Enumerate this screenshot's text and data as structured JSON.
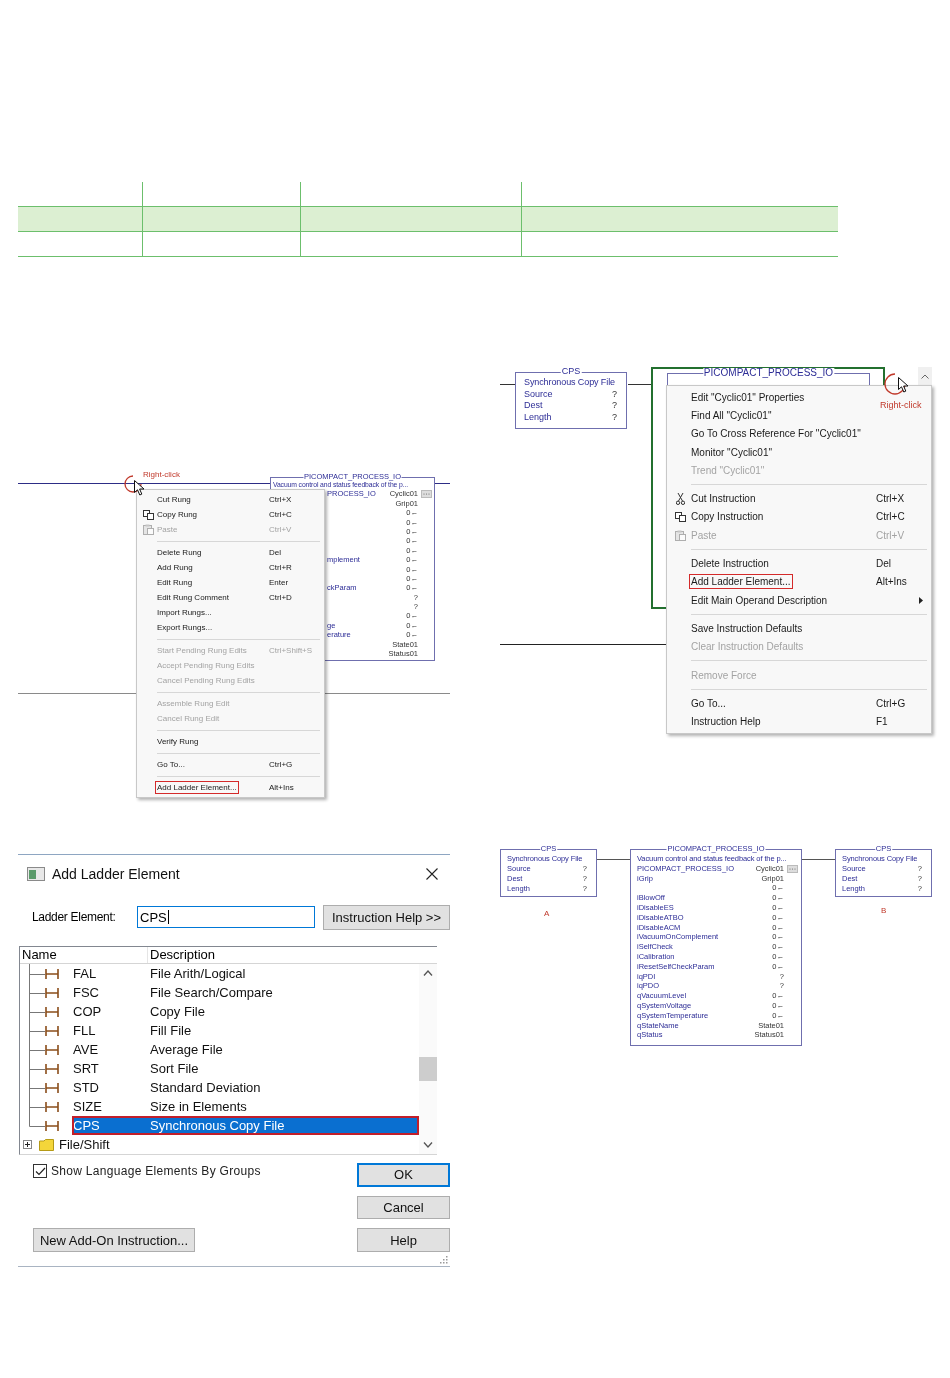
{
  "table": {
    "rows": [
      {
        "shaded": false
      },
      {
        "shaded": true
      },
      {
        "shaded": false
      }
    ]
  },
  "rung_menu_figure": {
    "callout": "Right-click",
    "instruction": {
      "title": "PICOMPACT_PROCESS_IO",
      "description": "Vacuum control and status feedback of the p...",
      "rows": [
        {
          "name": "PROCESS_IO",
          "value": "Cyclic01",
          "browse": true
        },
        {
          "value": "Grip01"
        },
        {
          "value": "0←"
        },
        {
          "value": "0←"
        },
        {
          "value": "0←"
        },
        {
          "value": "0←"
        },
        {
          "value": "0←"
        },
        {
          "name": "mplement",
          "value": "0←"
        },
        {
          "value": "0←"
        },
        {
          "value": "0←"
        },
        {
          "name": "ckParam",
          "value": "0←"
        },
        {
          "value": "?"
        },
        {
          "value": "?"
        },
        {
          "value": "0←"
        },
        {
          "name": "ge",
          "value": "0←"
        },
        {
          "name": "erature",
          "value": "0←"
        },
        {
          "value": "State01"
        },
        {
          "value": "Status01"
        }
      ]
    },
    "menu": {
      "groups": [
        {
          "items": [
            {
              "kind": "plain",
              "label": "Cut Rung",
              "shortcut": "Ctrl+X",
              "disabled": false,
              "boxed": false
            },
            {
              "kind": "copy",
              "label": "Copy Rung",
              "shortcut": "Ctrl+C",
              "disabled": false,
              "boxed": false
            },
            {
              "kind": "paste",
              "label": "Paste",
              "shortcut": "Ctrl+V",
              "disabled": true,
              "boxed": false
            }
          ]
        },
        {
          "items": [
            {
              "label": "Delete Rung",
              "shortcut": "Del",
              "disabled": false,
              "boxed": false
            },
            {
              "label": "Add Rung",
              "shortcut": "Ctrl+R",
              "disabled": false,
              "boxed": false
            },
            {
              "label": "Edit Rung",
              "shortcut": "Enter",
              "disabled": false,
              "boxed": false
            },
            {
              "label": "Edit Rung Comment",
              "shortcut": "Ctrl+D",
              "disabled": false,
              "boxed": false
            },
            {
              "label": "Import Rungs...",
              "disabled": false,
              "boxed": false
            },
            {
              "label": "Export Rungs...",
              "disabled": false,
              "boxed": false
            }
          ]
        },
        {
          "items": [
            {
              "label": "Start Pending Rung Edits",
              "shortcut": "Ctrl+Shift+S",
              "disabled": true,
              "boxed": false
            },
            {
              "label": "Accept Pending Rung Edits",
              "disabled": true,
              "boxed": false
            },
            {
              "label": "Cancel Pending Rung Edits",
              "disabled": true,
              "boxed": false
            }
          ]
        },
        {
          "items": [
            {
              "label": "Assemble Rung Edit",
              "disabled": true,
              "boxed": false
            },
            {
              "label": "Cancel Rung Edit",
              "disabled": true,
              "boxed": false
            }
          ]
        },
        {
          "items": [
            {
              "label": "Verify Rung",
              "disabled": false,
              "boxed": false
            }
          ]
        },
        {
          "items": [
            {
              "label": "Go To...",
              "shortcut": "Ctrl+G",
              "disabled": false,
              "boxed": false
            }
          ]
        },
        {
          "items": [
            {
              "label": "Add Ladder Element...",
              "shortcut": "Alt+Ins",
              "disabled": false,
              "boxed": true
            }
          ]
        }
      ]
    }
  },
  "instruction_menu_figure": {
    "callout": "Right-click",
    "cps_block": {
      "title": "CPS",
      "description": "Synchronous Copy File",
      "rows": [
        {
          "name": "Source",
          "value": "?"
        },
        {
          "name": "Dest",
          "value": "?"
        },
        {
          "name": "Length",
          "value": "?"
        }
      ]
    },
    "instruction": {
      "title": "PICOMPACT_PROCESS_IO",
      "selected": true
    },
    "menu": {
      "groups": [
        {
          "items": [
            {
              "label": "Edit \"Cyclic01\" Properties",
              "disabled": false,
              "boxed": false
            },
            {
              "label": "Find All \"Cyclic01\"",
              "disabled": false,
              "boxed": false
            },
            {
              "label": "Go To Cross Reference For \"Cyclic01\"",
              "disabled": false,
              "boxed": false
            },
            {
              "label": "Monitor \"Cyclic01\"",
              "disabled": false,
              "boxed": false
            },
            {
              "label": "Trend \"Cyclic01\"",
              "disabled": true,
              "boxed": false
            }
          ]
        },
        {
          "items": [
            {
              "kind": "cut",
              "label": "Cut Instruction",
              "shortcut": "Ctrl+X",
              "disabled": false,
              "boxed": false
            },
            {
              "kind": "copy",
              "label": "Copy Instruction",
              "shortcut": "Ctrl+C",
              "disabled": false,
              "boxed": false
            },
            {
              "kind": "paste",
              "label": "Paste",
              "shortcut": "Ctrl+V",
              "disabled": true,
              "boxed": false
            }
          ]
        },
        {
          "items": [
            {
              "label": "Delete Instruction",
              "shortcut": "Del",
              "disabled": false,
              "boxed": false
            },
            {
              "label": "Add Ladder Element...",
              "shortcut": "Alt+Ins",
              "disabled": false,
              "boxed": true
            },
            {
              "label": "Edit Main Operand Description",
              "submenu": true,
              "disabled": false,
              "boxed": false
            }
          ]
        },
        {
          "items": [
            {
              "label": "Save Instruction Defaults",
              "disabled": false,
              "boxed": false
            },
            {
              "label": "Clear Instruction Defaults",
              "disabled": true,
              "boxed": false
            }
          ]
        },
        {
          "items": [
            {
              "label": "Remove Force",
              "disabled": true,
              "boxed": false
            }
          ]
        },
        {
          "items": [
            {
              "label": "Go To...",
              "shortcut": "Ctrl+G",
              "disabled": false,
              "boxed": false
            },
            {
              "label": "Instruction Help",
              "shortcut": "F1",
              "disabled": false,
              "boxed": false
            }
          ]
        }
      ]
    }
  },
  "dialog": {
    "title": "Add Ladder Element",
    "field_label": "Ladder Element:",
    "field_value": "CPS",
    "help_button": "Instruction Help >>",
    "columns": [
      "Name",
      "Description"
    ],
    "items": [
      {
        "kind": "instruction",
        "name": "FAL",
        "description": "File Arith/Logical",
        "selected": false
      },
      {
        "kind": "instruction",
        "name": "FSC",
        "description": "File Search/Compare",
        "selected": false
      },
      {
        "kind": "instruction",
        "name": "COP",
        "description": "Copy File",
        "selected": false
      },
      {
        "kind": "instruction",
        "name": "FLL",
        "description": "Fill File",
        "selected": false
      },
      {
        "kind": "instruction",
        "name": "AVE",
        "description": "Average File",
        "selected": false
      },
      {
        "kind": "instruction",
        "name": "SRT",
        "description": "Sort File",
        "selected": false
      },
      {
        "kind": "instruction",
        "name": "STD",
        "description": "Standard Deviation",
        "selected": false
      },
      {
        "kind": "instruction",
        "name": "SIZE",
        "description": "Size in Elements",
        "selected": false
      },
      {
        "kind": "instruction",
        "name": "CPS",
        "description": "Synchronous Copy File",
        "selected": true
      },
      {
        "kind": "folder",
        "name": "File/Shift",
        "expanded": false,
        "selected": false
      }
    ],
    "checkbox": {
      "label": "Show Language Elements By Groups",
      "checked": true
    },
    "buttons": [
      {
        "label": "OK",
        "default": true
      },
      {
        "label": "Cancel",
        "default": false
      },
      {
        "label": "Help",
        "default": false
      }
    ],
    "add_on_button": "New Add-On Instruction..."
  },
  "result_figure": {
    "left_block": {
      "title": "CPS",
      "description": "Synchronous Copy File",
      "label": "A",
      "rows": [
        {
          "name": "Source",
          "value": "?"
        },
        {
          "name": "Dest",
          "value": "?"
        },
        {
          "name": "Length",
          "value": "?"
        }
      ]
    },
    "instruction": {
      "title": "PICOMPACT_PROCESS_IO",
      "description": "Vacuum control and status feedback of the p...",
      "rows": [
        {
          "name": "PICOMPACT_PROCESS_IO",
          "value": "Cyclic01",
          "browse": true
        },
        {
          "name": "iGrip",
          "value": "Grip01"
        },
        {
          "value": "0←"
        },
        {
          "name": "iBlowOff",
          "value": "0←"
        },
        {
          "name": "iDisableES",
          "value": "0←"
        },
        {
          "name": "iDisableATBO",
          "value": "0←"
        },
        {
          "name": "iDisableACM",
          "value": "0←"
        },
        {
          "name": "iVacuumOnComplement",
          "value": "0←"
        },
        {
          "name": "iSelfCheck",
          "value": "0←"
        },
        {
          "name": "iCalibration",
          "value": "0←"
        },
        {
          "name": "iResetSelfCheckParam",
          "value": "0←"
        },
        {
          "name": "iqPDI",
          "value": "?"
        },
        {
          "name": "iqPDO",
          "value": "?"
        },
        {
          "name": "qVacuumLevel",
          "value": "0←"
        },
        {
          "name": "qSystemVoltage",
          "value": "0←"
        },
        {
          "name": "qSystemTemperature",
          "value": "0←"
        },
        {
          "name": "qStateName",
          "value": "State01"
        },
        {
          "name": "qStatus",
          "value": "Status01"
        }
      ]
    },
    "right_block": {
      "title": "CPS",
      "description": "Synchronous Copy File",
      "label": "B",
      "rows": [
        {
          "name": "Source",
          "value": "?"
        },
        {
          "name": "Dest",
          "value": "?"
        },
        {
          "name": "Length",
          "value": "?"
        }
      ]
    }
  }
}
